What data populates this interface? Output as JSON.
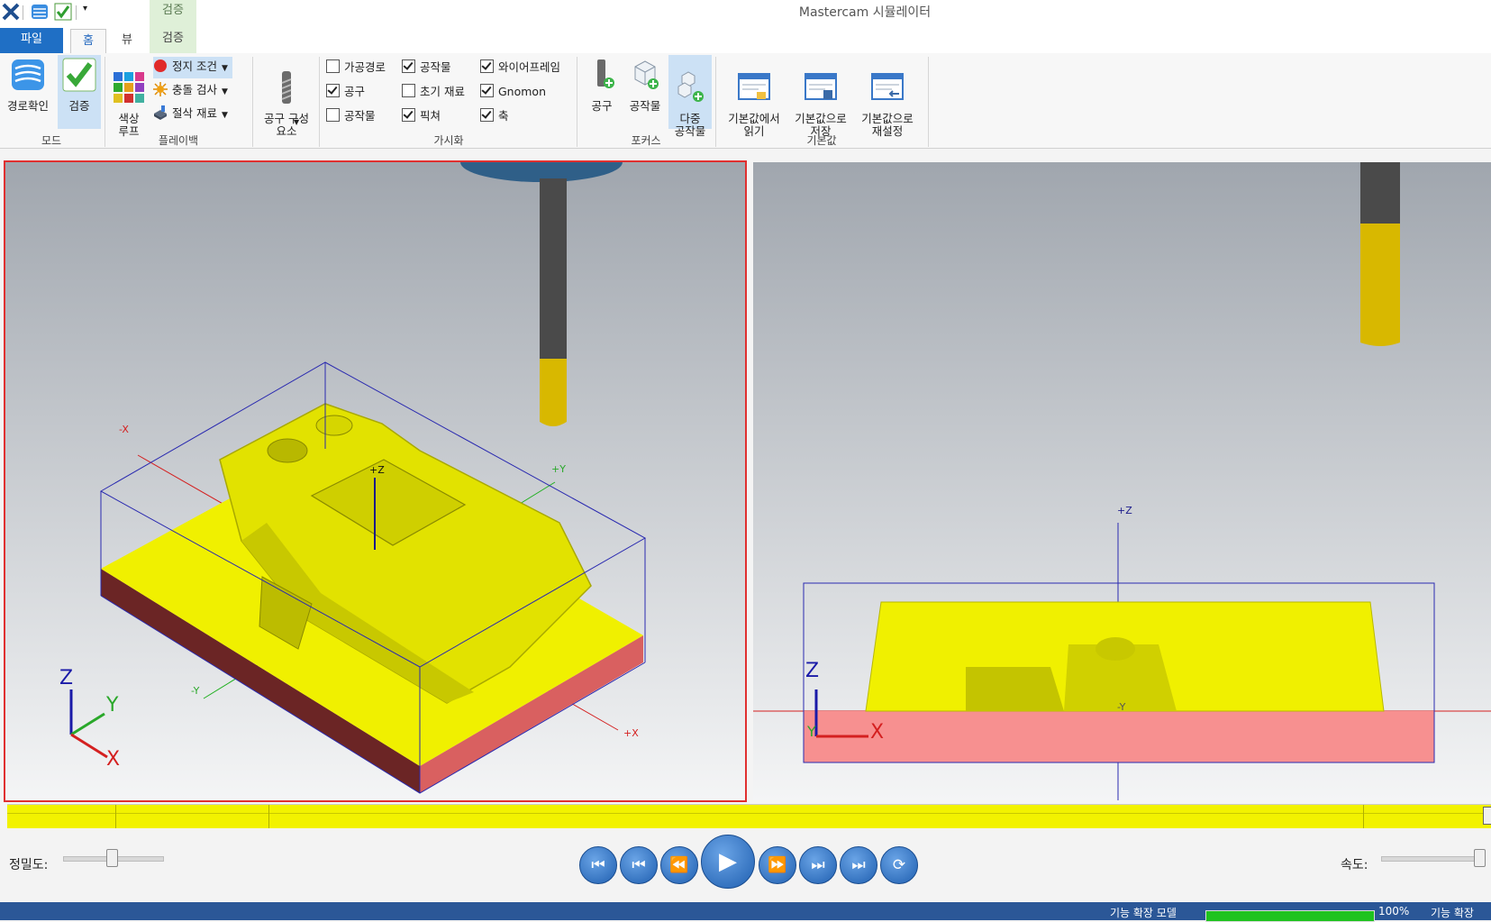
{
  "window": {
    "title": "Mastercam 시뮬레이터",
    "context_tab": "검증"
  },
  "tabs": {
    "file": "파일",
    "home": "홈",
    "view": "뷰",
    "verify": "검증"
  },
  "ribbon": {
    "mode": {
      "label": "모드",
      "path_check": "경로확인",
      "verify": "검증"
    },
    "playback": {
      "label": "플레이백",
      "color_loop": "색상\n루프",
      "stop_condition": "정지 조건",
      "collision_check": "충돌 검사",
      "cut_stock": "절삭 재료"
    },
    "tool_component": "공구 구성\n요소",
    "visibility": {
      "label": "가시화",
      "items": [
        {
          "label": "가공경로",
          "checked": false
        },
        {
          "label": "공작물",
          "checked": true
        },
        {
          "label": "와이어프레임",
          "checked": true
        },
        {
          "label": "공구",
          "checked": true
        },
        {
          "label": "초기 재료",
          "checked": false
        },
        {
          "label": "Gnomon",
          "checked": true
        },
        {
          "label": "공작물",
          "checked": false
        },
        {
          "label": "픽쳐",
          "checked": true
        },
        {
          "label": "축",
          "checked": true
        }
      ]
    },
    "focus": {
      "label": "포커스",
      "tool": "공구",
      "workpiece": "공작물",
      "multi": "다중\n공작물"
    },
    "defaults": {
      "label": "기본값",
      "load": "기본값에서\n읽기",
      "save": "기본값으로\n저장",
      "reset": "기본값으로\n재설정"
    }
  },
  "viewport_left": {
    "axes": {
      "minus_x": "-X",
      "plus_x": "+X",
      "plus_y": "+Y",
      "minus_y": "-Y",
      "plus_z": "+Z"
    },
    "gnomon": {
      "x": "X",
      "y": "Y",
      "z": "Z"
    }
  },
  "viewport_right": {
    "axes": {
      "plus_z": "+Z",
      "minus_y": "-Y"
    },
    "gnomon": {
      "x": "X",
      "y": "Y",
      "z": "Z"
    }
  },
  "controls": {
    "precision_label": "정밀도:",
    "speed_label": "속도:",
    "precision_level": 0.25,
    "speed_level": 1.0
  },
  "status": {
    "left": "기능 확장 모델",
    "progress": "100%",
    "right": "기능 확장"
  },
  "colors": {
    "accent": "#1f6fc5",
    "part": "#f2f200",
    "stock": "#d96060",
    "status_bar": "#2b5797"
  }
}
